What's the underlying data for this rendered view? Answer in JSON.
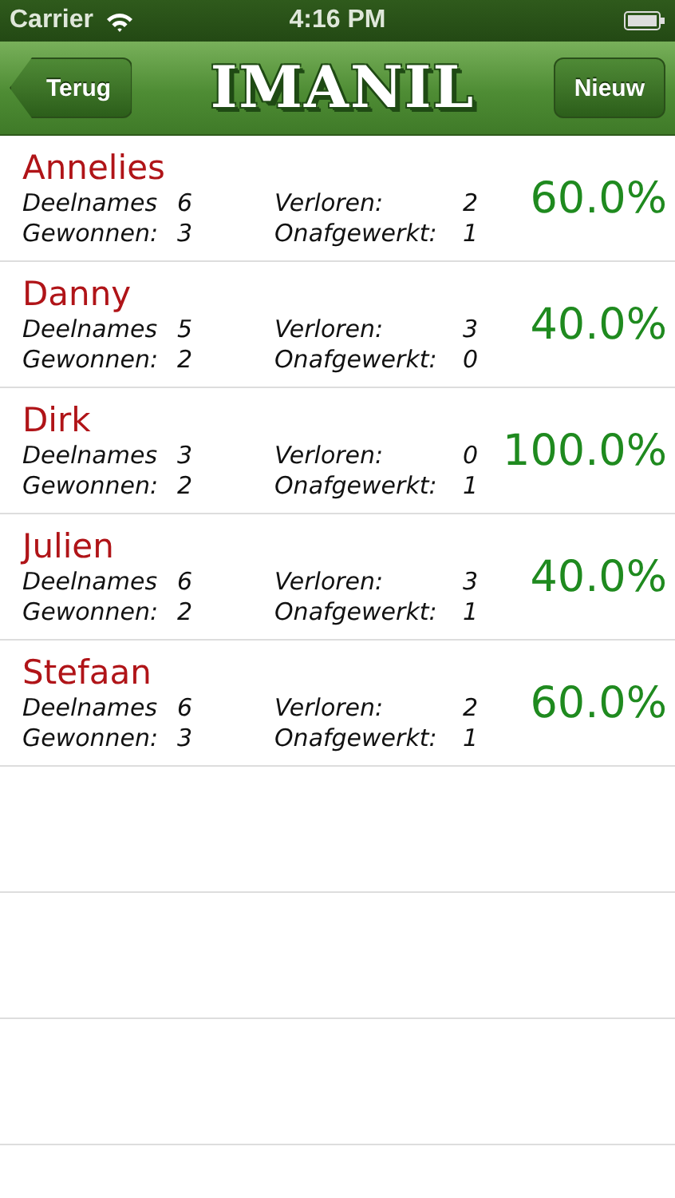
{
  "status_bar": {
    "carrier": "Carrier",
    "time": "4:16 PM"
  },
  "nav_bar": {
    "back": "Terug",
    "title": "IMANIL",
    "action": "Nieuw"
  },
  "players": [
    {
      "name": "Annelies",
      "percent": "60.0%",
      "stats": [
        {
          "label": "Deelnames",
          "value": "6"
        },
        {
          "label": "Verloren:",
          "value": "2"
        },
        {
          "label": "Gewonnen:",
          "value": "3"
        },
        {
          "label": "Onafgewerkt:",
          "value": "1"
        }
      ]
    },
    {
      "name": "Danny",
      "percent": "40.0%",
      "stats": [
        {
          "label": "Deelnames",
          "value": "5"
        },
        {
          "label": "Verloren:",
          "value": "3"
        },
        {
          "label": "Gewonnen:",
          "value": "2"
        },
        {
          "label": "Onafgewerkt:",
          "value": "0"
        }
      ]
    },
    {
      "name": "Dirk",
      "percent": "100.0%",
      "stats": [
        {
          "label": "Deelnames",
          "value": "3"
        },
        {
          "label": "Verloren:",
          "value": "0"
        },
        {
          "label": "Gewonnen:",
          "value": "2"
        },
        {
          "label": "Onafgewerkt:",
          "value": "1"
        }
      ]
    },
    {
      "name": "Julien",
      "percent": "40.0%",
      "stats": [
        {
          "label": "Deelnames",
          "value": "6"
        },
        {
          "label": "Verloren:",
          "value": "3"
        },
        {
          "label": "Gewonnen:",
          "value": "2"
        },
        {
          "label": "Onafgewerkt:",
          "value": "1"
        }
      ]
    },
    {
      "name": "Stefaan",
      "percent": "60.0%",
      "stats": [
        {
          "label": "Deelnames",
          "value": "6"
        },
        {
          "label": "Verloren:",
          "value": "2"
        },
        {
          "label": "Gewonnen:",
          "value": "3"
        },
        {
          "label": "Onafgewerkt:",
          "value": "1"
        }
      ]
    }
  ]
}
